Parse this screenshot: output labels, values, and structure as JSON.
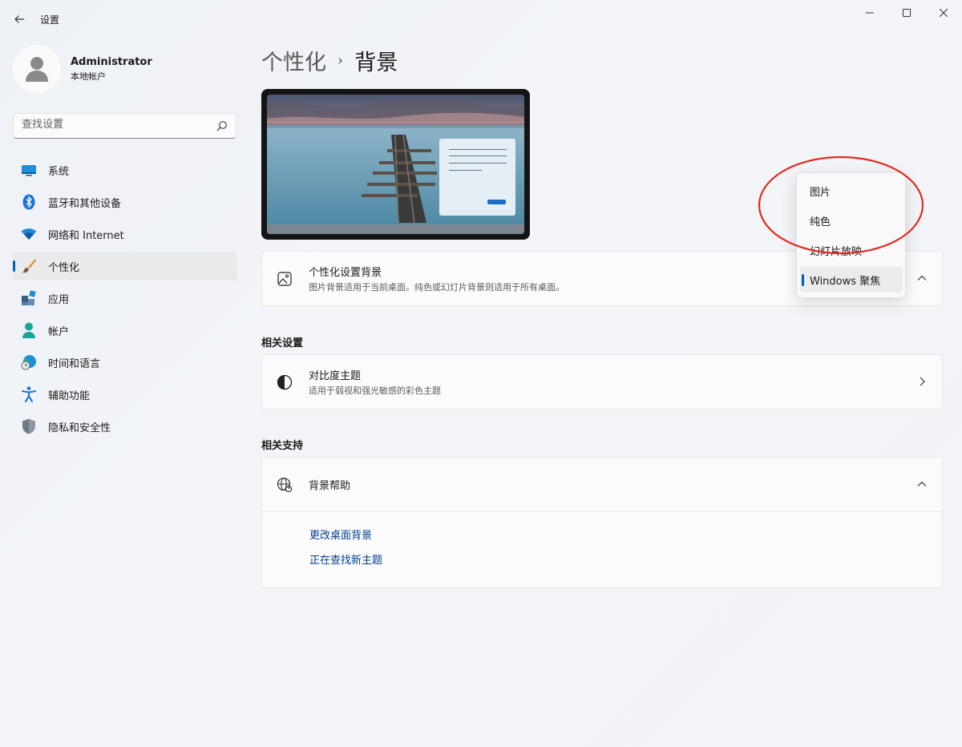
{
  "window": {
    "title": "设置",
    "back_icon": "back-arrow-icon",
    "controls": [
      "minimize-icon",
      "maximize-icon",
      "close-icon"
    ]
  },
  "profile": {
    "name": "Administrator",
    "account_type": "本地帐户"
  },
  "search": {
    "placeholder": "查找设置"
  },
  "sidebar": {
    "items": [
      {
        "label": "系统",
        "icon": "system-icon"
      },
      {
        "label": "蓝牙和其他设备",
        "icon": "bluetooth-icon"
      },
      {
        "label": "网络和 Internet",
        "icon": "wifi-icon"
      },
      {
        "label": "个性化",
        "icon": "brush-icon",
        "active": true
      },
      {
        "label": "应用",
        "icon": "apps-icon"
      },
      {
        "label": "帐户",
        "icon": "person-icon"
      },
      {
        "label": "时间和语言",
        "icon": "globe-clock-icon"
      },
      {
        "label": "辅助功能",
        "icon": "accessibility-icon"
      },
      {
        "label": "隐私和安全性",
        "icon": "shield-icon"
      }
    ]
  },
  "header": {
    "parent": "个性化",
    "separator": "›",
    "current": "背景"
  },
  "background_card": {
    "title": "个性化设置背景",
    "description": "图片背景适用于当前桌面。纯色或幻灯片背景则适用于所有桌面。"
  },
  "dropdown": {
    "options": [
      "图片",
      "纯色",
      "幻灯片放映",
      "Windows 聚焦"
    ],
    "selected": "Windows 聚焦"
  },
  "related_settings": {
    "heading": "相关设置",
    "contrast": {
      "title": "对比度主题",
      "description": "适用于弱视和强光敏感的彩色主题"
    }
  },
  "related_support": {
    "heading": "相关支持",
    "help_title": "背景帮助",
    "links": [
      "更改桌面背景",
      "正在查找新主题"
    ]
  },
  "colors": {
    "accent": "#005fb8",
    "link": "#003e92",
    "annotation": "#e02a1f"
  }
}
